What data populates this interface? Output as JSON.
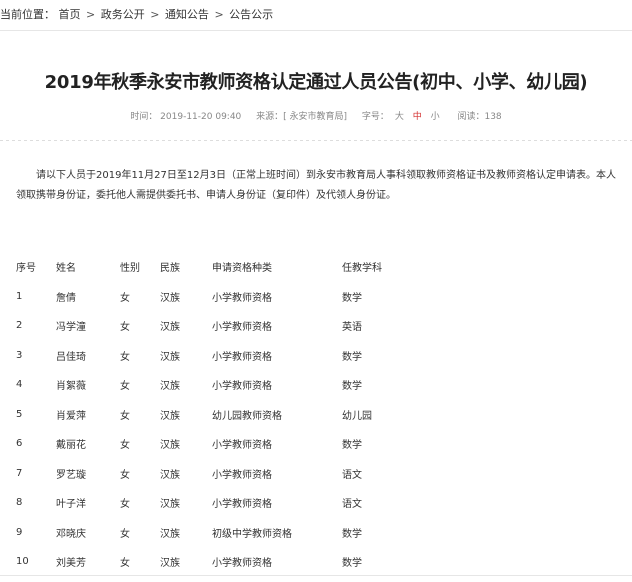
{
  "breadcrumb": {
    "label": "当前位置：",
    "items": [
      "首页",
      "政务公开",
      "通知公告",
      "公告公示"
    ],
    "separator": ">"
  },
  "article": {
    "title": "2019年秋季永安市教师资格认定通过人员公告(初中、小学、幼儿园)",
    "meta": {
      "time": "时间：  2019-11-20 09:40",
      "source": "来源：[ 永安市教育局]",
      "font_size_label": "字号：",
      "sizes": [
        "大",
        "中",
        "小"
      ],
      "views": "阅读：138"
    },
    "notice": "请以下人员于2019年11月27日至12月3日（正常上班时间）到永安市教育局人事科领取教师资格证书及教师资格认定申请表。本人领取携带身份证，委托他人需提供委托书、申请人身份证（复印件）及代领人身份证。"
  },
  "table": {
    "headers": [
      "序号",
      "姓名",
      "性别",
      "民族",
      "申请资格种类",
      "任教学科"
    ],
    "rows": [
      [
        "1",
        "詹倩",
        "女",
        "汉族",
        "小学教师资格",
        "数学"
      ],
      [
        "2",
        "冯学潼",
        "女",
        "汉族",
        "小学教师资格",
        "英语"
      ],
      [
        "3",
        "吕佳琦",
        "女",
        "汉族",
        "小学教师资格",
        "数学"
      ],
      [
        "4",
        "肖絮薇",
        "女",
        "汉族",
        "小学教师资格",
        "数学"
      ],
      [
        "5",
        "肖爱萍",
        "女",
        "汉族",
        "幼儿园教师资格",
        "幼儿园"
      ],
      [
        "6",
        "戴丽花",
        "女",
        "汉族",
        "小学教师资格",
        "数学"
      ],
      [
        "7",
        "罗艺璇",
        "女",
        "汉族",
        "小学教师资格",
        "语文"
      ],
      [
        "8",
        "叶子洋",
        "女",
        "汉族",
        "小学教师资格",
        "语文"
      ],
      [
        "9",
        "邓晓庆",
        "女",
        "汉族",
        "初级中学教师资格",
        "数学"
      ],
      [
        "10",
        "刘美芳",
        "女",
        "汉族",
        "小学教师资格",
        "数学"
      ]
    ]
  }
}
